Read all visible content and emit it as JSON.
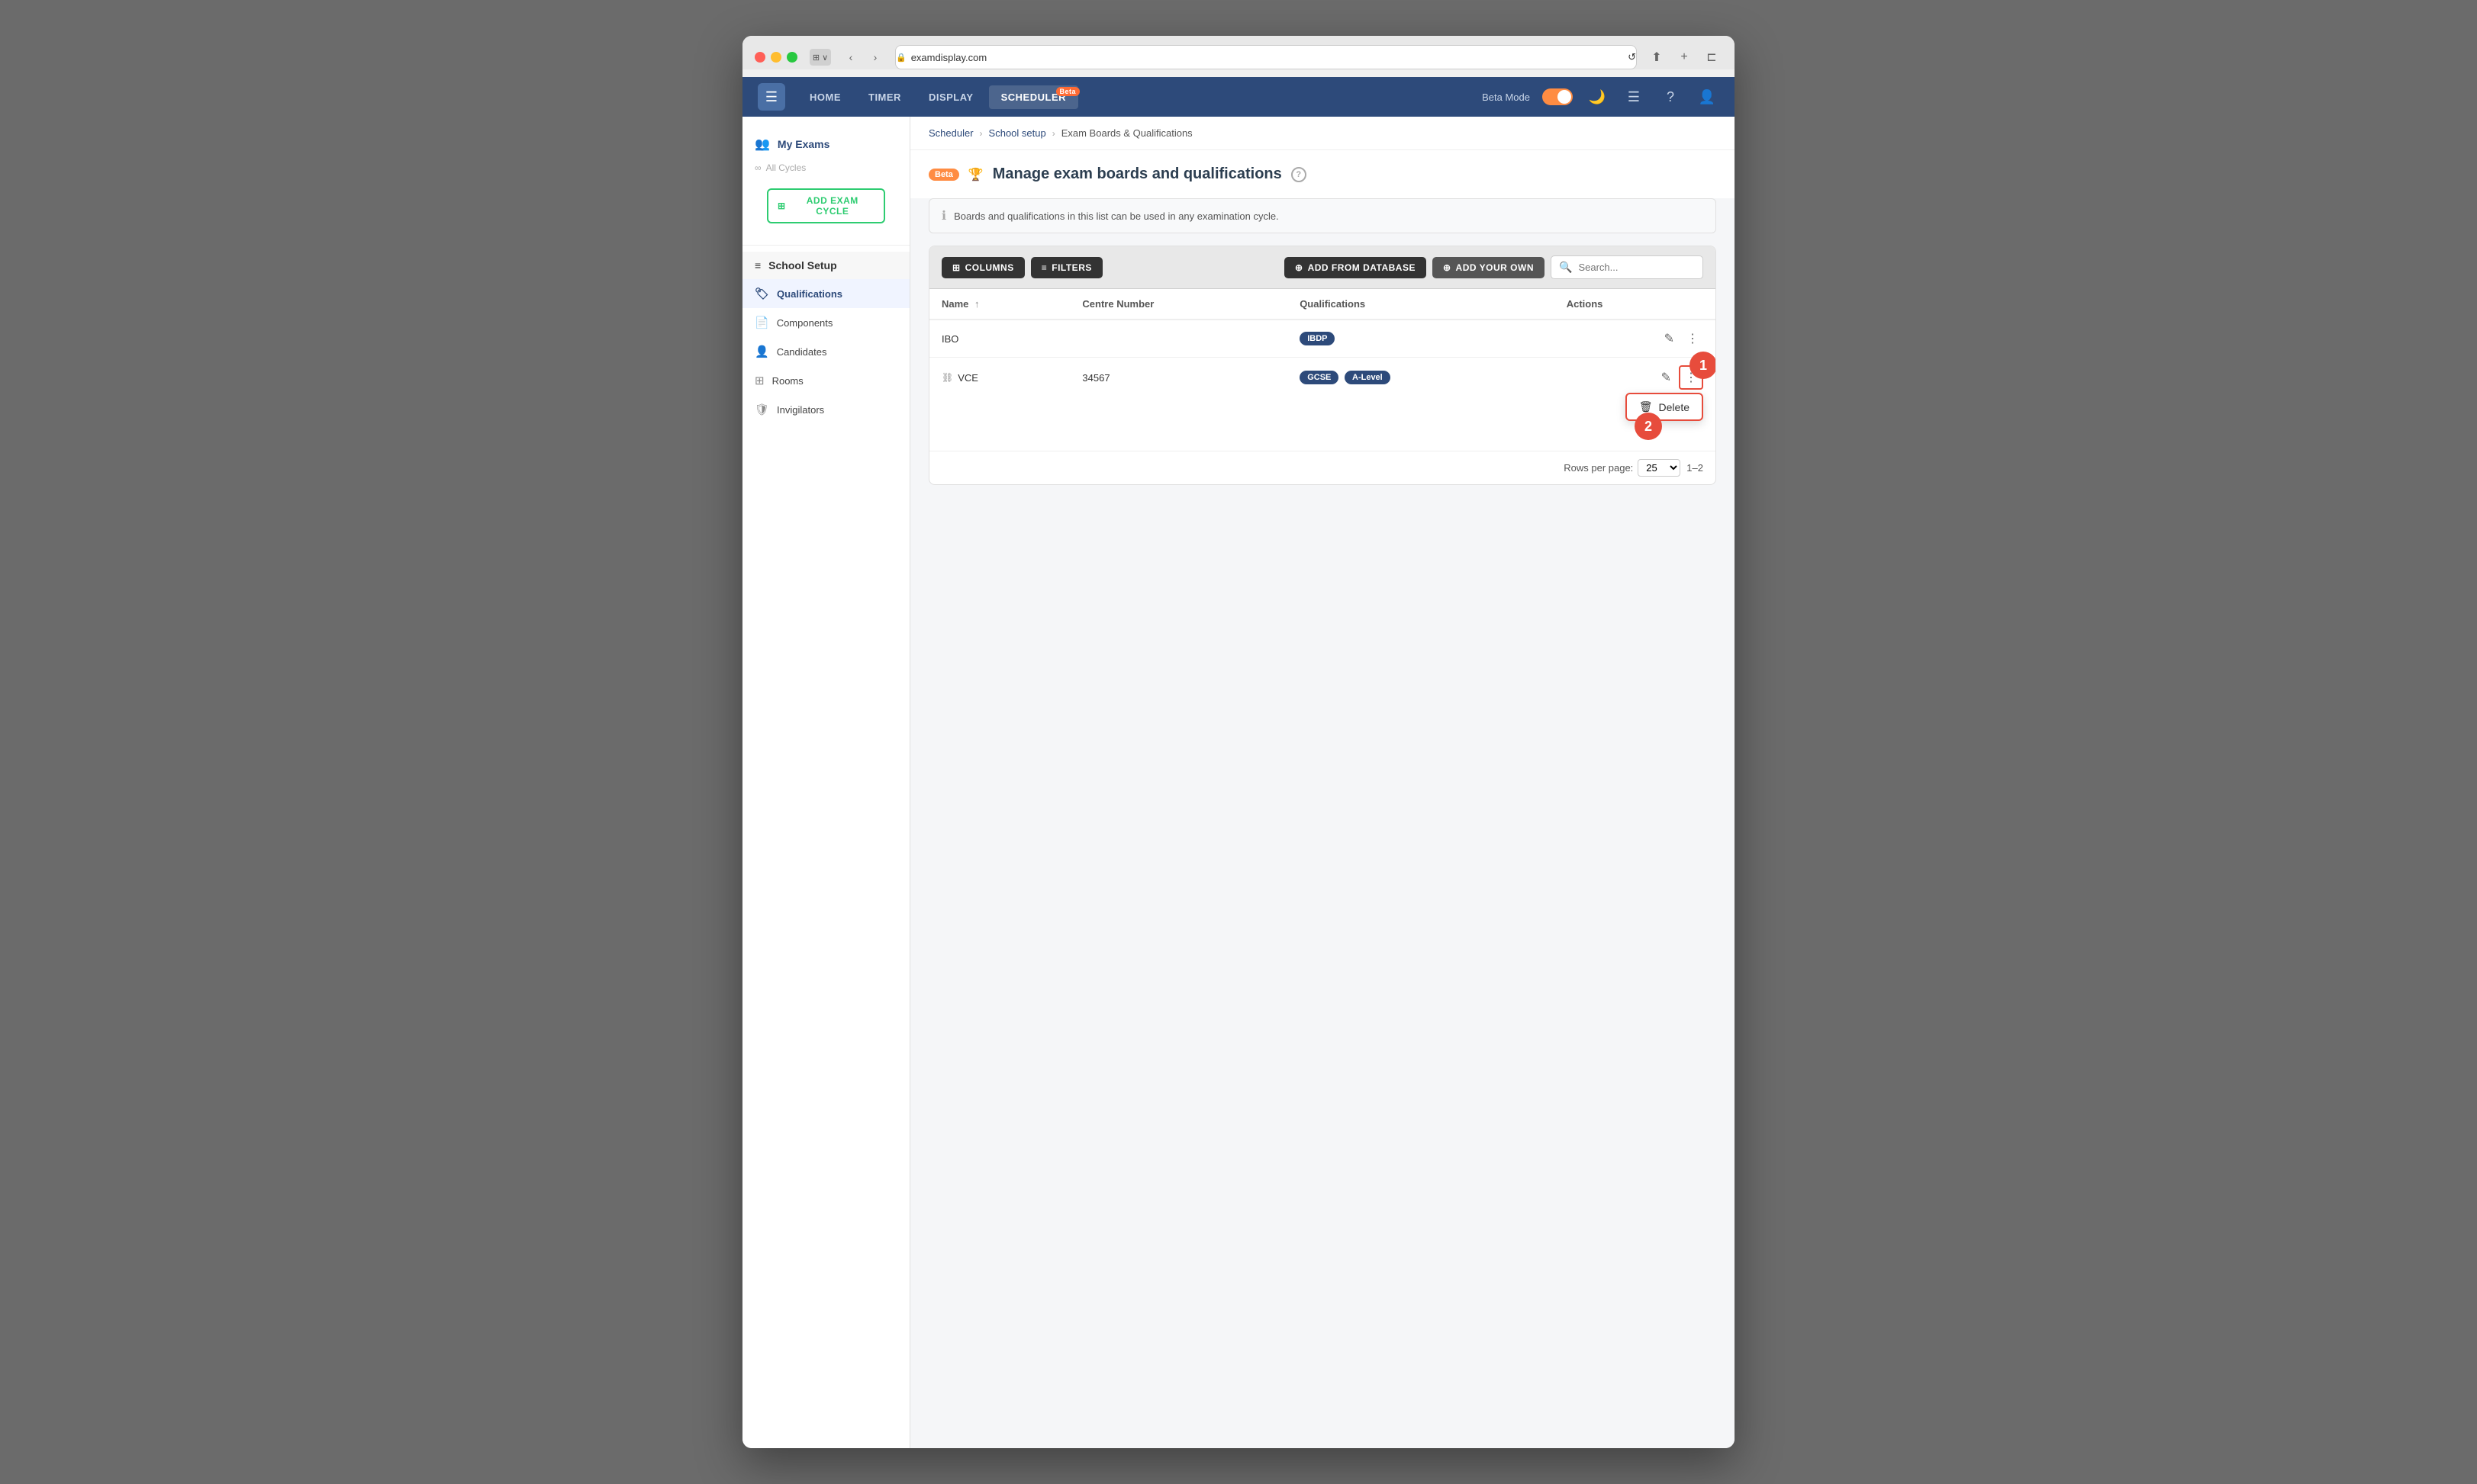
{
  "browser": {
    "url": "examdisplay.com",
    "reload_label": "↺"
  },
  "header": {
    "logo_symbol": "☰",
    "nav_tabs": [
      {
        "label": "HOME",
        "active": false
      },
      {
        "label": "TIMER",
        "active": false
      },
      {
        "label": "DISPLAY",
        "active": false
      },
      {
        "label": "SCHEDULER",
        "active": true,
        "badge": "Beta"
      }
    ],
    "beta_mode_label": "Beta Mode",
    "icons": [
      "🌙",
      "☰",
      "?",
      "👤"
    ]
  },
  "sidebar": {
    "my_exams_label": "My Exams",
    "all_cycles_label": "All Cycles",
    "add_exam_cycle_label": "ADD EXAM CYCLE",
    "school_setup_label": "School Setup",
    "menu_items": [
      {
        "label": "Qualifications",
        "icon": "🏷",
        "active": true
      },
      {
        "label": "Components",
        "icon": "📄",
        "active": false
      },
      {
        "label": "Candidates",
        "icon": "👤",
        "active": false
      },
      {
        "label": "Rooms",
        "icon": "⊞",
        "active": false
      },
      {
        "label": "Invigilators",
        "icon": "🛡",
        "active": false
      }
    ]
  },
  "breadcrumb": {
    "items": [
      "Scheduler",
      "School setup",
      "Exam Boards & Qualifications"
    ]
  },
  "page": {
    "beta_tag": "Beta",
    "title": "Manage exam boards and qualifications",
    "info_text": "Boards and qualifications in this list can be used in any examination cycle."
  },
  "toolbar": {
    "columns_label": "COLUMNS",
    "filters_label": "FILTERS",
    "add_from_db_label": "ADD FROM DATABASE",
    "add_your_own_label": "ADD YOUR OWN",
    "search_placeholder": "Search..."
  },
  "table": {
    "columns": [
      {
        "label": "Name",
        "sortable": true
      },
      {
        "label": "Centre Number",
        "sortable": false
      },
      {
        "label": "Qualifications",
        "sortable": false
      },
      {
        "label": "Actions",
        "sortable": false
      }
    ],
    "rows": [
      {
        "name": "IBO",
        "has_icon": false,
        "centre_number": "",
        "qualifications": [
          "IBDP"
        ]
      },
      {
        "name": "VCE",
        "has_icon": true,
        "centre_number": "34567",
        "qualifications": [
          "GCSE",
          "A-Level"
        ]
      }
    ],
    "footer": {
      "rows_per_page_label": "Rows per page:",
      "rows_per_page_value": "25",
      "pagination": "1–2"
    }
  },
  "callouts": {
    "one": "1",
    "two": "2"
  },
  "delete_menu": {
    "label": "Delete",
    "icon": "🗑"
  }
}
